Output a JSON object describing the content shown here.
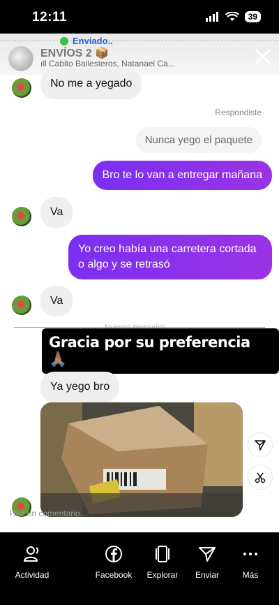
{
  "status_bar": {
    "time": "12:11",
    "battery": "39"
  },
  "header": {
    "sent_status": "Enviado..",
    "group_title": "ENVÍOS 2 📦",
    "participants": "Cabito Ballesteros, Natanael Ca..."
  },
  "messages": [
    {
      "side": "in",
      "text": "No me a yegado"
    },
    {
      "side": "meta",
      "text": "Respondiste"
    },
    {
      "side": "reply",
      "text": "Nunca yego el paquete"
    },
    {
      "side": "out",
      "text": "Bro te lo van a entregar mañana"
    },
    {
      "side": "in",
      "text": "Va"
    },
    {
      "side": "out",
      "text": "Yo creo había una carretera cortada o algo y se retrasó"
    },
    {
      "side": "in",
      "text": "Va"
    }
  ],
  "new_messages_label": "Nuevos mensajes",
  "story_caption": "Gracia por su preferencia 🙏🏽",
  "last_message": "Ya yego bro",
  "comment_placeholder": "Haz un comentario...",
  "bottom_nav": [
    {
      "label": "Actividad",
      "icon": "activity-icon"
    },
    {
      "label": "Facebook",
      "icon": "facebook-icon"
    },
    {
      "label": "Explorar",
      "icon": "explore-icon"
    },
    {
      "label": "Enviar",
      "icon": "send-icon"
    },
    {
      "label": "Más",
      "icon": "more-icon"
    }
  ]
}
